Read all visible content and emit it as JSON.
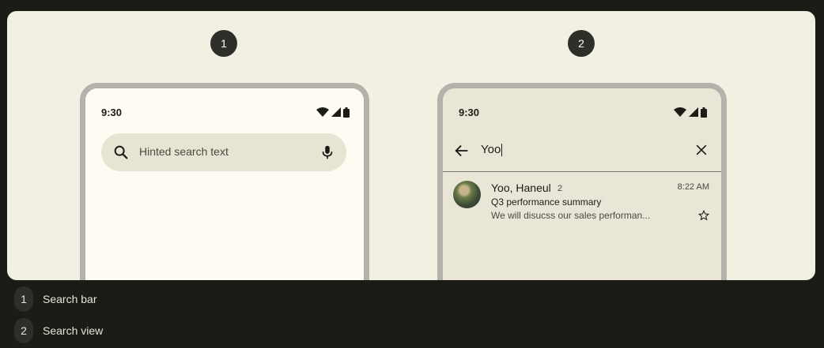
{
  "steps": {
    "one": "1",
    "two": "2"
  },
  "phone1": {
    "status_time": "9:30",
    "search_placeholder": "Hinted search text",
    "icons": [
      "search-icon",
      "mic-icon"
    ]
  },
  "phone2": {
    "status_time": "9:30",
    "query": "Yoo",
    "icons": [
      "back-arrow-icon",
      "close-icon"
    ],
    "result": {
      "sender": "Yoo, Haneul",
      "count": "2",
      "time": "8:22 AM",
      "subject": "Q3 performance summary",
      "preview": "We will disucss our sales performan..."
    }
  },
  "legend": [
    {
      "number": "1",
      "label": "Search bar"
    },
    {
      "number": "2",
      "label": "Search view"
    }
  ],
  "colors": {
    "page_bg": "#1c1c17",
    "canvas_bg": "#f2efe3",
    "phone1_bg": "#fefbf2",
    "phone2_bg": "#e9e6d7",
    "searchbar_bg": "#e7e4d4",
    "badge_bg": "#2f2f2a",
    "frame": "#b3b3ac"
  }
}
